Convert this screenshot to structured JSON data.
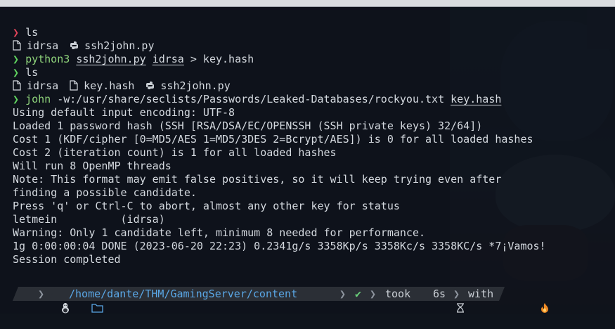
{
  "terminal": {
    "lines": [
      {
        "prompt": "❯",
        "text": "ls"
      },
      {
        "files": [
          "idrsa",
          "ssh2john.py"
        ]
      },
      {
        "prompt": "❯",
        "cmd": "python3",
        "arg1": "ssh2john.py",
        "arg2": "idrsa",
        "rest": " > key.hash"
      },
      {
        "prompt": "❯",
        "text": "ls"
      },
      {
        "files": [
          "idrsa",
          "key.hash",
          "ssh2john.py"
        ]
      },
      {
        "prompt": "❯",
        "cmd": "john",
        "rest": " -w:/usr/share/seclists/Passwords/Leaked-Databases/rockyou.txt ",
        "arg1": "key.hash"
      },
      {
        "text": "Using default input encoding: UTF-8"
      },
      {
        "text": "Loaded 1 password hash (SSH [RSA/DSA/EC/OPENSSH (SSH private keys) 32/64])"
      },
      {
        "text": "Cost 1 (KDF/cipher [0=MD5/AES 1=MD5/3DES 2=Bcrypt/AES]) is 0 for all loaded hashes"
      },
      {
        "text": "Cost 2 (iteration count) is 1 for all loaded hashes"
      },
      {
        "text": "Will run 8 OpenMP threads"
      },
      {
        "text": "Note: This format may emit false positives, so it will keep trying even after"
      },
      {
        "text": "finding a possible candidate."
      },
      {
        "text": "Press 'q' or Ctrl-C to abort, almost any other key for status"
      },
      {
        "text": "letmein          (idrsa)"
      },
      {
        "text": "Warning: Only 1 candidate left, minimum 8 needed for performance."
      },
      {
        "text": "1g 0:00:00:04 DONE (2023-06-20 22:23) 0.2341g/s 3358Kp/s 3358Kc/s 3358KC/s *7¡Vamos!"
      },
      {
        "text": "Session completed"
      }
    ]
  },
  "prompt_bar": {
    "path_prefix": "/home/dante/THM/GamingServer/",
    "path_current": "content",
    "status": "✔",
    "took_label": "took",
    "took_value": "6s",
    "with_label": "with",
    "with_icon": "fire-icon"
  },
  "colors": {
    "background": "#0f141c",
    "text": "#d4d9df",
    "prompt_red": "#e0445a",
    "prompt_green": "#5fd35f",
    "path_blue": "#5aa7e6"
  }
}
